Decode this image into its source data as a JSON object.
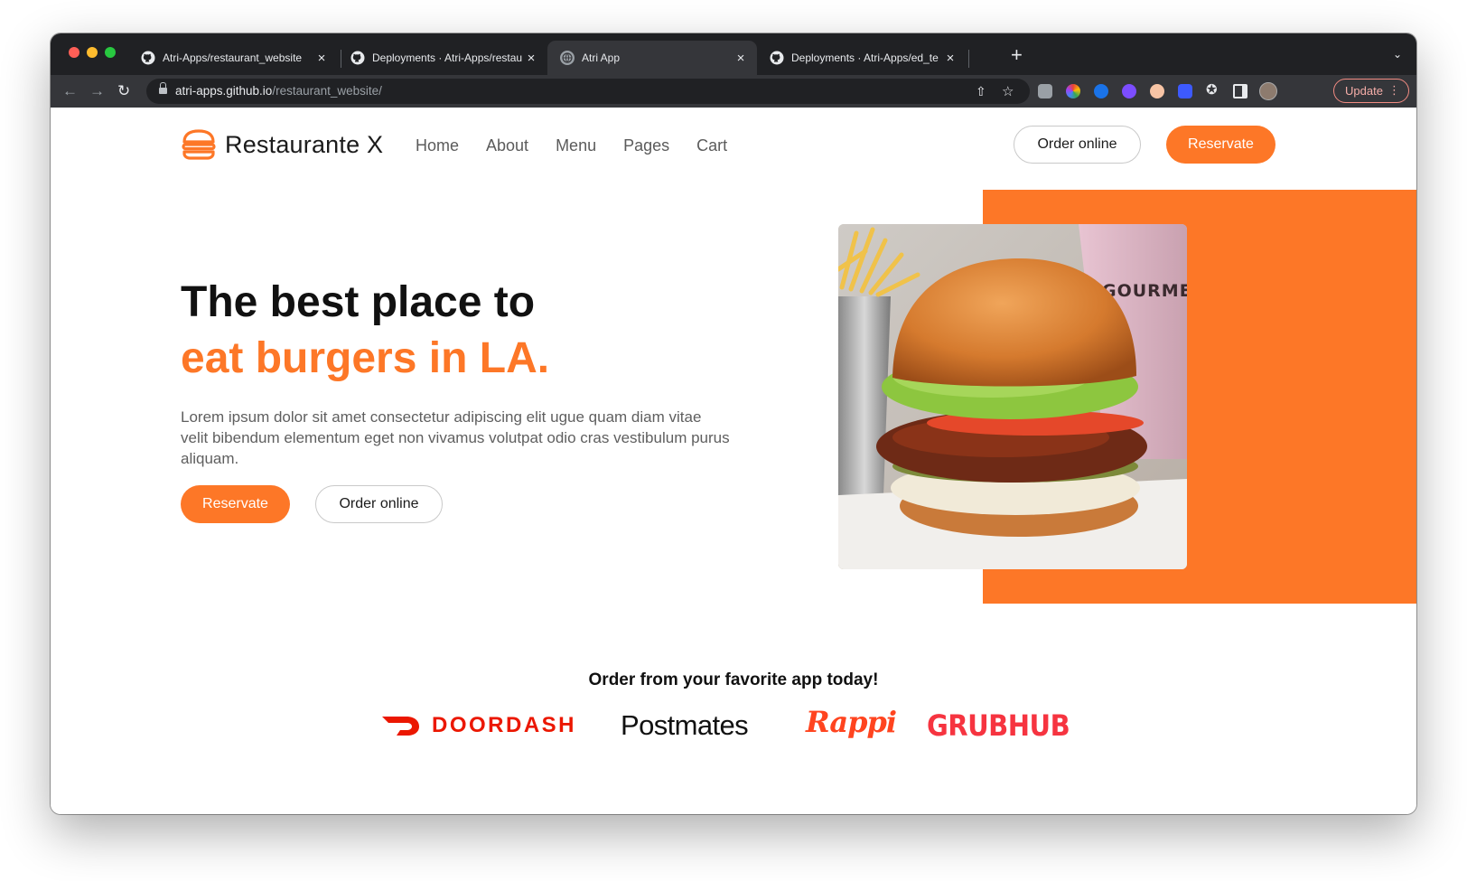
{
  "browser": {
    "tabs": [
      {
        "title": "Atri-Apps/restaurant_website",
        "icon": "github-icon",
        "active": false
      },
      {
        "title": "Deployments · Atri-Apps/restau",
        "icon": "github-icon",
        "active": false
      },
      {
        "title": "Atri App",
        "icon": "globe-icon",
        "active": true
      },
      {
        "title": "Deployments · Atri-Apps/ed_te",
        "icon": "github-icon",
        "active": false
      }
    ],
    "url_host": "atri-apps.github.io",
    "url_path": "/restaurant_website/",
    "update_label": "Update"
  },
  "site": {
    "brand": "Restaurante X",
    "nav": [
      "Home",
      "About",
      "Menu",
      "Pages",
      "Cart"
    ],
    "header_order_label": "Order online",
    "header_reserve_label": "Reservate",
    "accent_color": "#fd7727"
  },
  "hero": {
    "headline_line1": "The best place to",
    "headline_line2": "eat burgers in LA.",
    "lead": "Lorem ipsum dolor sit amet consectetur adipiscing elit ugue quam diam vitae velit bibendum elementum eget non vivamus volutpat odio cras vestibulum purus aliquam.",
    "reserve_label": "Reservate",
    "order_label": "Order online",
    "image_label": "GOURMET BURGER KITCHEN"
  },
  "apps": {
    "title": "Order from your favorite app today!",
    "logos": [
      "DOORDASH",
      "Postmates",
      "Rappi",
      "GRUBHUB"
    ]
  }
}
